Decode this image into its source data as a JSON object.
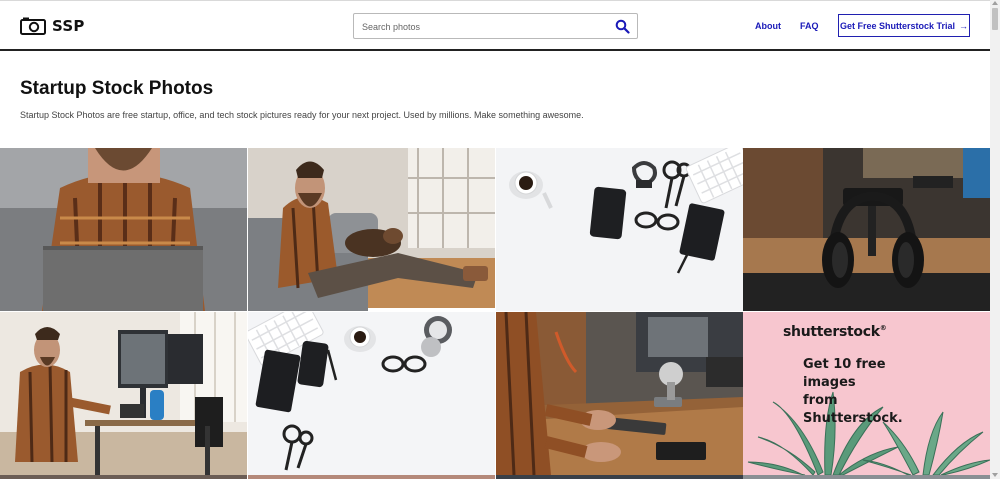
{
  "header": {
    "logo_text": "SSP",
    "search_placeholder": "Search photos",
    "nav": {
      "about": "About",
      "faq": "FAQ"
    },
    "cta_label": "Get Free Shutterstock Trial",
    "cta_arrow": "→"
  },
  "hero": {
    "title": "Startup Stock Photos",
    "subtitle": "Startup Stock Photos are free startup, office, and tech stock pictures ready for your next project. Used by millions. Make something awesome."
  },
  "ad": {
    "brand": "shutterstock",
    "brand_mark": "®",
    "line1": "Get 10 free images",
    "line2": "from Shutterstock."
  },
  "colors": {
    "accent": "#1a1ab8",
    "ad_background": "#f7c6cf",
    "header_rule": "#222222"
  }
}
